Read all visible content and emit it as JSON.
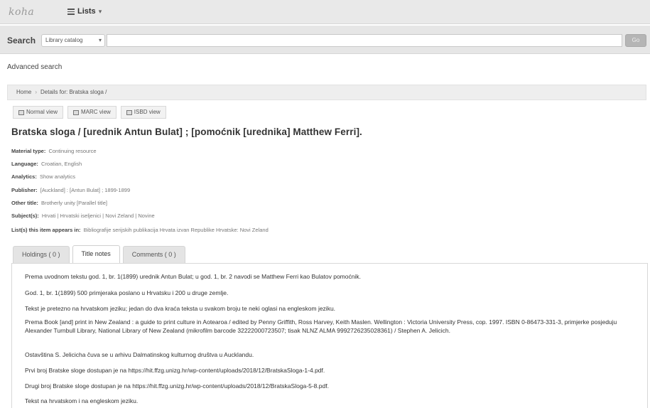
{
  "header": {
    "logo": "koha",
    "lists_label": "Lists",
    "lists_icon": "list-icon",
    "caret": "▾"
  },
  "search": {
    "label": "Search",
    "scope": "Library catalog",
    "placeholder": "",
    "go_label": "Go"
  },
  "advanced_search": "Advanced search",
  "breadcrumb": {
    "home": "Home",
    "current": "Details for: Bratska sloga /"
  },
  "view_tabs": [
    "Normal view",
    "MARC view",
    "ISBD view"
  ],
  "record": {
    "title": "Bratska sloga / [urednik Antun Bulat] ; [pomoćnik [urednika] Matthew Ferri].",
    "fields": [
      {
        "label": "Material type:",
        "value": "Continuing resource"
      },
      {
        "label": "Language:",
        "value": "Croatian, English"
      },
      {
        "label": "Analytics:",
        "value": "Show analytics"
      },
      {
        "label": "Publisher:",
        "value": "[Auckland] : [Antun Bulat] ; 1899-1899"
      },
      {
        "label": "Other title:",
        "value": "Brotherly unity [Parallel title]"
      },
      {
        "label": "Subject(s):",
        "value": "Hrvati | Hrvatski iseljenici | Novi Zeland | Novine"
      },
      {
        "label": "List(s) this item appears in:",
        "value": "Bibliografije serijskih publikacija Hrvata izvan Republike Hrvatske: Novi Zeland"
      }
    ]
  },
  "detail_tabs": [
    "Holdings ( 0 )",
    "Title notes",
    "Comments ( 0 )"
  ],
  "active_tab": "Title notes",
  "title_notes": [
    "Prema uvodnom tekstu god. 1, br. 1(1899) urednik Antun Bulat; u god. 1, br. 2 navodi se Matthew Ferri kao Bulatov pomoćnik.",
    "God. 1, br. 1(1899) 500 primjeraka poslano u Hrvatsku i 200 u druge zemlje.",
    "Tekst je pretezno na hrvatskom jeziku; jedan do dva kraća teksta u svakom broju te neki oglasi na engleskom jeziku.",
    "Prema Book [and] print in New Zealand : a guide to print culture in Aotearoa / edited by Penny Griffith, Ross Harvey, Keith Maslen. Wellington : Victoria University Press, cop. 1997. ISBN 0-86473-331-3, primjerke posjeduju Alexander Turnbull Library, National Library of New Zealand (mikrofilm barcode 32222000723507; tisak NLNZ ALMA 9992726235028361) / Stephen A. Jelicich.",
    "Ostavština S. Jelicicha čuva se u arhivu Dalmatinskog kulturnog društva u Aucklandu.",
    "Prvi broj Bratske sloge dostupan je na https://hit.ffzg.unizg.hr/wp-content/uploads/2018/12/BratskaSloga-1-4.pdf.",
    "Drugi broj Bratske sloge dostupan je na https://hit.ffzg.unizg.hr/wp-content/uploads/2018/12/BratskaSloga-5-8.pdf.",
    "Tekst na hrvatskom i na engleskom jeziku."
  ]
}
